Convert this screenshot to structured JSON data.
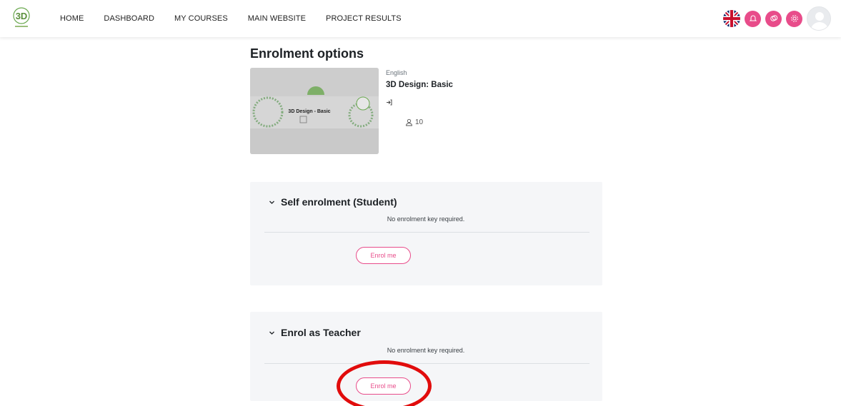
{
  "nav": {
    "links": [
      "HOME",
      "DASHBOARD",
      "MY COURSES",
      "MAIN WEBSITE",
      "PROJECT RESULTS"
    ],
    "logo_text": "3D",
    "colors": {
      "accent": "#e84c8a"
    }
  },
  "page": {
    "title": "Enrolment options"
  },
  "course": {
    "language": "English",
    "name": "3D Design: Basic",
    "image_caption": "3D Design - Basic",
    "participants": "10"
  },
  "panels": [
    {
      "title": "Self enrolment (Student)",
      "note": "No enrolment key required.",
      "button": "Enrol me"
    },
    {
      "title": "Enrol as Teacher",
      "note": "No enrolment key required.",
      "button": "Enrol me"
    }
  ]
}
